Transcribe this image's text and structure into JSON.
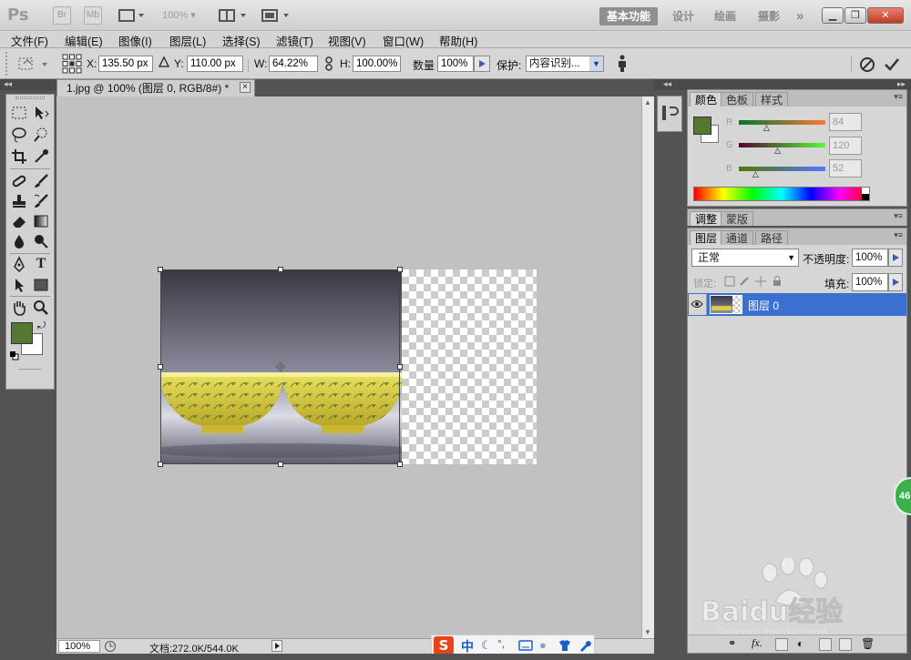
{
  "titlebar": {
    "app_logo": "Ps",
    "bridge": "Br",
    "mini_bridge": "Mb",
    "zoom": "100%",
    "workspaces": [
      "基本功能",
      "设计",
      "绘画",
      "摄影"
    ],
    "more": "»"
  },
  "menu": [
    "文件(F)",
    "编辑(E)",
    "图像(I)",
    "图层(L)",
    "选择(S)",
    "滤镜(T)",
    "视图(V)",
    "窗口(W)",
    "帮助(H)"
  ],
  "options": {
    "x_label": "X:",
    "x_value": "135.50 px",
    "y_label": "Y:",
    "y_value": "110.00 px",
    "w_label": "W:",
    "w_value": "64.22%",
    "h_label": "H:",
    "h_value": "100.00%",
    "amount_label": "数量",
    "amount_value": "100%",
    "protect_label": "保护:",
    "protect_value": "内容识别..."
  },
  "document": {
    "tab_title": "1.jpg @ 100% (图层 0, RGB/8#) *",
    "close": "×"
  },
  "statusbar": {
    "zoom": "100%",
    "doc_info": "文档:272.0K/544.0K"
  },
  "color_panel": {
    "tabs": [
      "颜色",
      "色板",
      "样式"
    ],
    "r_label": "R",
    "r_value": "84",
    "g_label": "G",
    "g_value": "120",
    "b_label": "B",
    "b_value": "52",
    "fg_color": "#547834"
  },
  "adjust_panel": {
    "tabs": [
      "调整",
      "蒙版"
    ]
  },
  "layers_panel": {
    "tabs": [
      "图层",
      "通道",
      "路径"
    ],
    "blend_mode": "正常",
    "opacity_label": "不透明度:",
    "opacity_value": "100%",
    "lock_label": "锁定:",
    "fill_label": "填充:",
    "fill_value": "100%",
    "layers": [
      {
        "name": "图层 0",
        "selected": true
      }
    ]
  },
  "ime_bar": {
    "logo": "S",
    "mode": "中"
  },
  "floating_badge": "46",
  "watermark": {
    "brand": "Baidu经验",
    "url": "jingyan.baidu.com"
  }
}
